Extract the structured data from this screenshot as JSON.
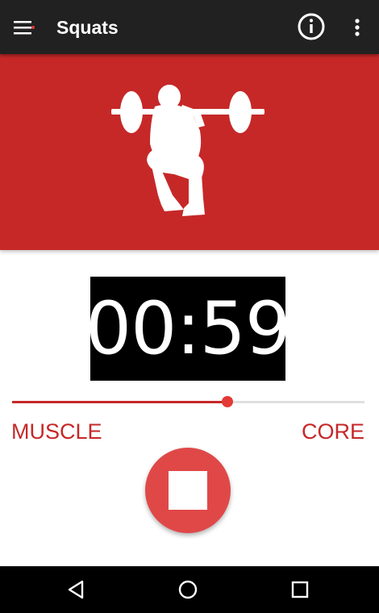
{
  "app_bar": {
    "title": "Squats",
    "menu_icon": "hamburger-menu-icon",
    "info_icon": "info-icon",
    "overflow_icon": "more-vert-icon"
  },
  "hero": {
    "image": "squat-with-barbell-silhouette",
    "background_color": "#c62828"
  },
  "timer": {
    "display": "00:59"
  },
  "slider": {
    "value_fraction": 0.61,
    "left_label": "MUSCLE",
    "right_label": "CORE",
    "accent_color": "#c62828"
  },
  "controls": {
    "stop_icon": "stop-icon",
    "button_color": "#e04848"
  },
  "system_nav": {
    "back_icon": "back-triangle-icon",
    "home_icon": "home-circle-icon",
    "recents_icon": "recents-square-icon"
  }
}
